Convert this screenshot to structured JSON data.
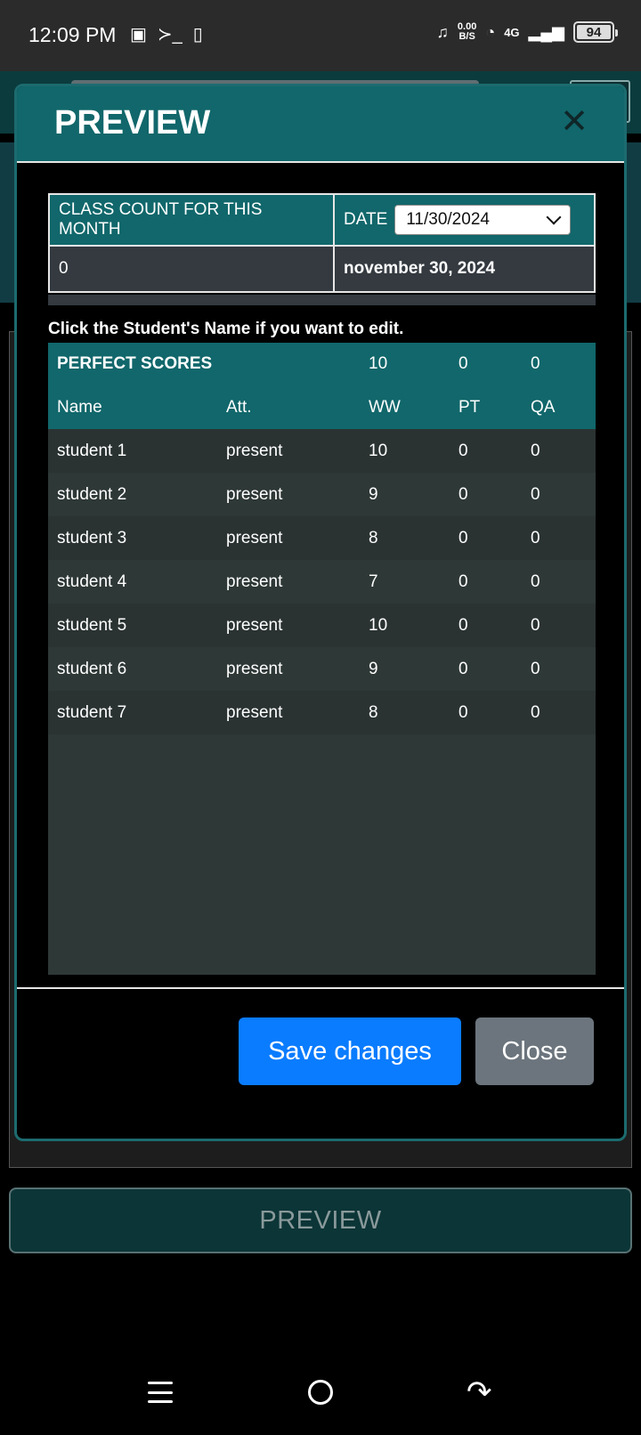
{
  "status_bar": {
    "time": "12:09 PM",
    "net_speed_value": "0.00",
    "net_speed_unit": "B/S",
    "network": "4G",
    "battery": "94"
  },
  "background": {
    "preview_button_label": "PREVIEW"
  },
  "modal": {
    "title": "PREVIEW",
    "close_symbol": "✕",
    "info": {
      "class_count_label": "CLASS COUNT FOR THIS MONTH",
      "date_label": "DATE",
      "date_value": "11/30/2024",
      "class_count_value": "0",
      "date_long": "november 30, 2024"
    },
    "hint": "Click the Student's Name if you want to edit.",
    "scores": {
      "perfect_label": "PERFECT SCORES",
      "perfect_ww": "10",
      "perfect_pt": "0",
      "perfect_qa": "0",
      "headers": [
        "Name",
        "Att.",
        "WW",
        "PT",
        "QA"
      ],
      "rows": [
        [
          "student 1",
          "present",
          "10",
          "0",
          "0"
        ],
        [
          "student 2",
          "present",
          "9",
          "0",
          "0"
        ],
        [
          "student 3",
          "present",
          "8",
          "0",
          "0"
        ],
        [
          "student 4",
          "present",
          "7",
          "0",
          "0"
        ],
        [
          "student 5",
          "present",
          "10",
          "0",
          "0"
        ],
        [
          "student 6",
          "present",
          "9",
          "0",
          "0"
        ],
        [
          "student 7",
          "present",
          "8",
          "0",
          "0"
        ]
      ]
    },
    "footer": {
      "save_label": "Save changes",
      "close_label": "Close"
    }
  },
  "colors": {
    "teal_header": "#11676b",
    "primary_button": "#0a7cff",
    "secondary_button": "#6c757d",
    "row_dark": "#2e3836"
  }
}
